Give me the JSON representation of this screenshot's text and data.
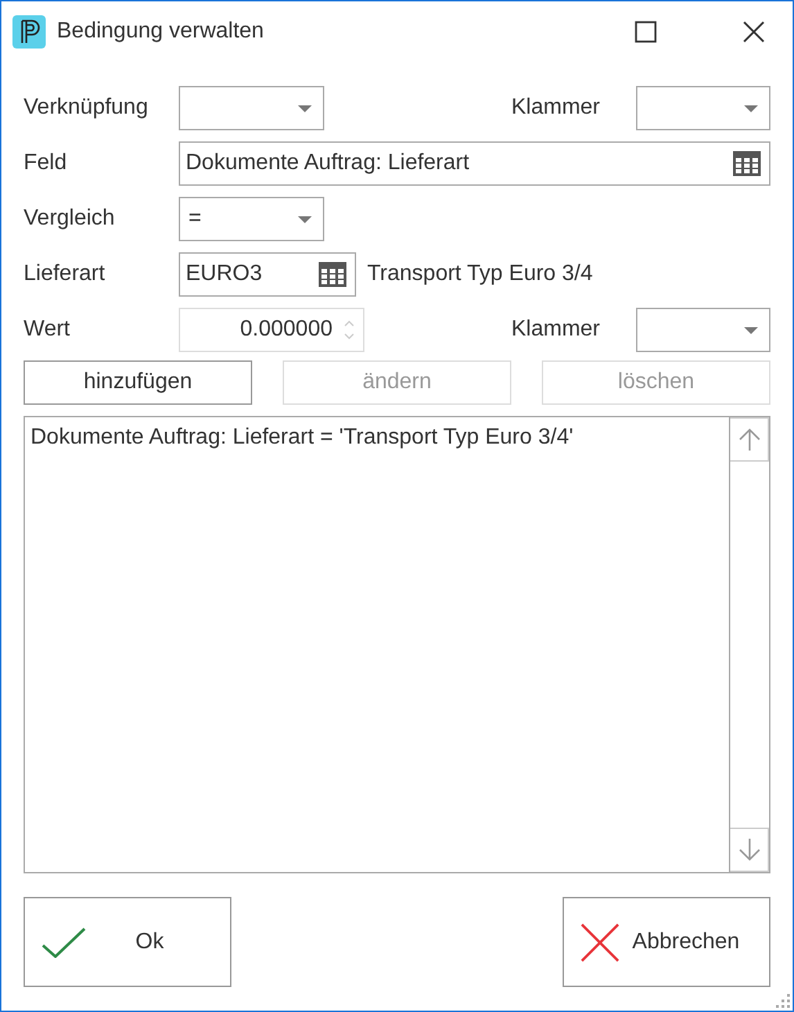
{
  "window": {
    "title": "Bedingung verwalten"
  },
  "form": {
    "verknuepfung": {
      "label": "Verknüpfung"
    },
    "klammer_open": {
      "label": "Klammer"
    },
    "feld": {
      "label": "Feld",
      "value": "Dokumente Auftrag: Lieferart"
    },
    "vergleich": {
      "label": "Vergleich",
      "value": "="
    },
    "lieferart": {
      "label": "Lieferart",
      "value": "EURO3",
      "description": "Transport Typ Euro 3/4"
    },
    "wert": {
      "label": "Wert",
      "value": "0.000000"
    },
    "klammer_close": {
      "label": "Klammer"
    }
  },
  "actions": [
    {
      "label": "hinzufügen",
      "disabled": false
    },
    {
      "label": "ändern",
      "disabled": true
    },
    {
      "label": "löschen",
      "disabled": true
    }
  ],
  "conditions": [
    "Dokumente Auftrag: Lieferart = 'Transport Typ Euro 3/4'"
  ],
  "footer_buttons": [
    {
      "kind": "ok",
      "label": "Ok"
    },
    {
      "kind": "cancel",
      "label": "Abbrechen"
    }
  ]
}
